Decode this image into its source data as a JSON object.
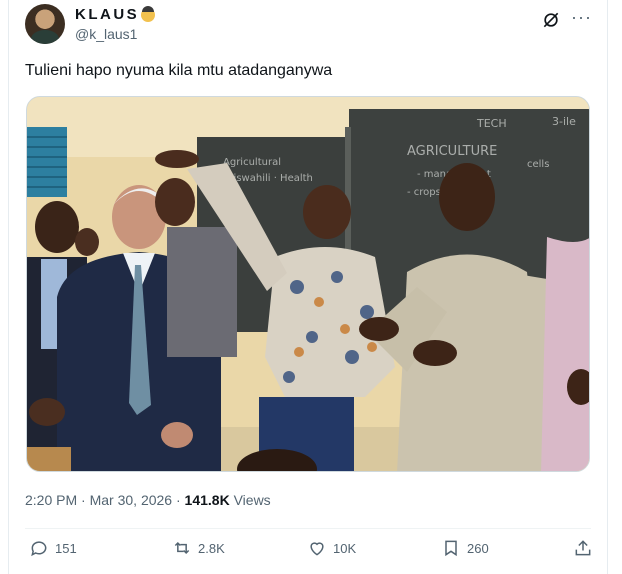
{
  "author": {
    "display_name": "KLAUS",
    "emoji": "detective-emoji",
    "handle": "@k_laus1"
  },
  "tweet": {
    "text": "Tulieni hapo nyuma kila mtu atadanganywa",
    "time": "2:20 PM",
    "separator": "·",
    "date": "Mar 30, 2026",
    "views_count": "141.8K",
    "views_label": "Views"
  },
  "photo": {
    "board_text_1": "AGRICULTURE",
    "board_text_2": "TECH",
    "board_text_3": "3-ile"
  },
  "actions": {
    "replies": "151",
    "reposts": "2.8K",
    "likes": "10K",
    "bookmarks": "260"
  },
  "icons": {
    "header": [
      "grok-icon",
      "more-icon"
    ],
    "actions": [
      "reply-icon",
      "repost-icon",
      "like-icon",
      "bookmark-icon",
      "share-icon"
    ]
  },
  "colors": {
    "text": "#0f1419",
    "muted": "#536471",
    "border": "#cfd9de"
  }
}
